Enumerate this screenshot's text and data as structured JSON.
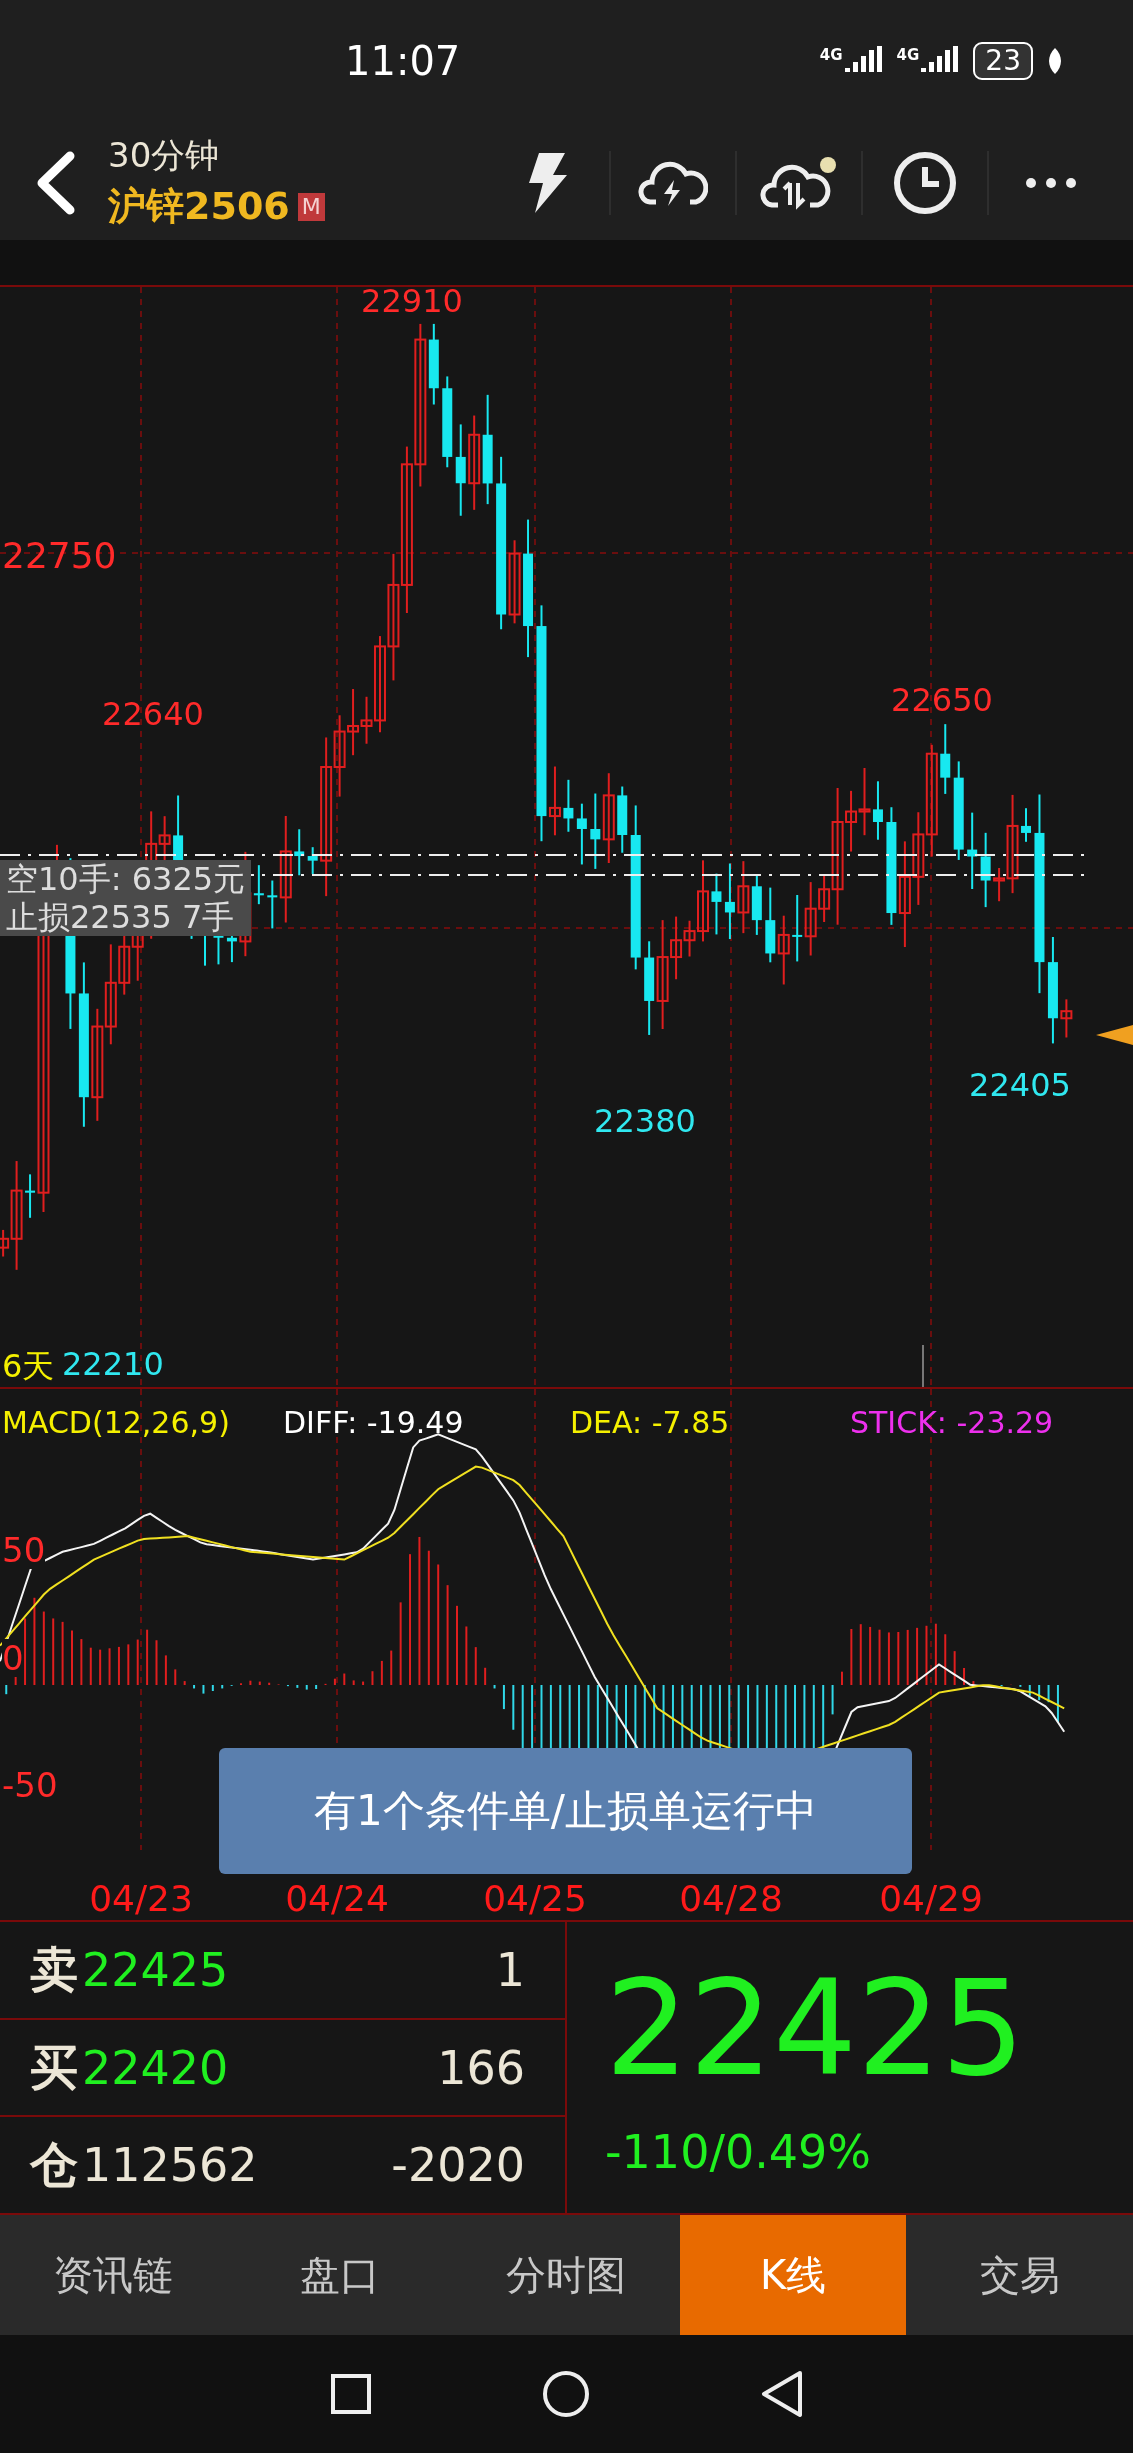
{
  "status_bar": {
    "time": "11:07",
    "network_1": "4G",
    "network_2": "4G",
    "battery": "23"
  },
  "header": {
    "period": "30分钟",
    "instrument": "沪锌2506",
    "badge": "M"
  },
  "kline": {
    "price_tick": "22750",
    "extremes": [
      {
        "text": "22910",
        "kind": "high"
      },
      {
        "text": "22640",
        "kind": "high"
      },
      {
        "text": "22650",
        "kind": "high"
      },
      {
        "text": "22380",
        "kind": "low"
      },
      {
        "text": "22405",
        "kind": "low"
      },
      {
        "text": "22210",
        "kind": "low"
      }
    ],
    "period_days": "6天",
    "order_lines": [
      "空10手: 6325元",
      "止损22535 7手"
    ]
  },
  "macd": {
    "title": "MACD(12,26,9)",
    "diff": "DIFF: -19.49",
    "dea": "DEA: -7.85",
    "stick": "STICK: -23.29",
    "ticks": [
      "50",
      "0",
      "-50"
    ]
  },
  "toast": "有1个条件单/止损单运行中",
  "dates": [
    "04/23",
    "04/24",
    "04/25",
    "04/28",
    "04/29"
  ],
  "quote": {
    "rows": [
      {
        "kind": "sell",
        "label": "卖",
        "price": "22425",
        "volume": "1"
      },
      {
        "kind": "buy",
        "label": "买",
        "price": "22420",
        "volume": "166"
      },
      {
        "kind": "open_interest",
        "label": "仓",
        "price": "112562",
        "volume": "-2020"
      }
    ],
    "last_price": "22425",
    "change": "-110/0.49%"
  },
  "tabs": [
    {
      "label": "资讯链",
      "selected": false
    },
    {
      "label": "盘口",
      "selected": false
    },
    {
      "label": "分时图",
      "selected": false
    },
    {
      "label": "K线",
      "selected": true
    },
    {
      "label": "交易",
      "selected": false
    }
  ]
}
